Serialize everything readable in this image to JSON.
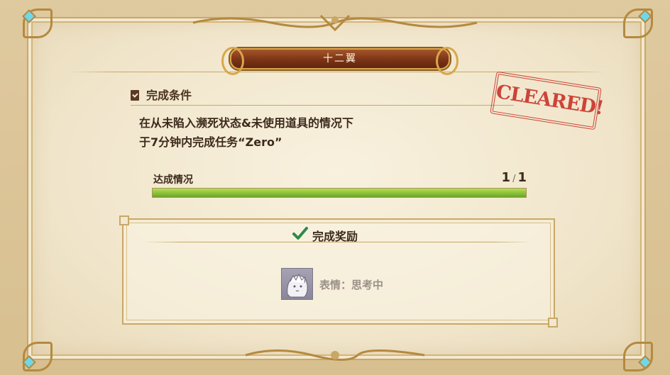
{
  "banner": {
    "title": "十二翼"
  },
  "condition_section": {
    "title": "完成条件",
    "lines": [
      "在从未陷入濒死状态&未使用道具的情况下",
      "于7分钟内完成任务“Zero”"
    ]
  },
  "stamp": {
    "text": "CLEARED!"
  },
  "progress": {
    "label": "达成情况",
    "current": "1",
    "separator": "/",
    "total": "1",
    "fraction": 1.0
  },
  "reward": {
    "title": "完成奖励",
    "item_text": "表情：思考中"
  },
  "icons": {
    "condition": "document-check-icon",
    "reward": "checkmark-icon",
    "reward_item": "emote-portrait-icon"
  },
  "colors": {
    "stamp_red": "#c8332a",
    "progress_green": "#8cc43a",
    "banner_brown": "#7b3416",
    "gold_trim": "#c9a865"
  }
}
